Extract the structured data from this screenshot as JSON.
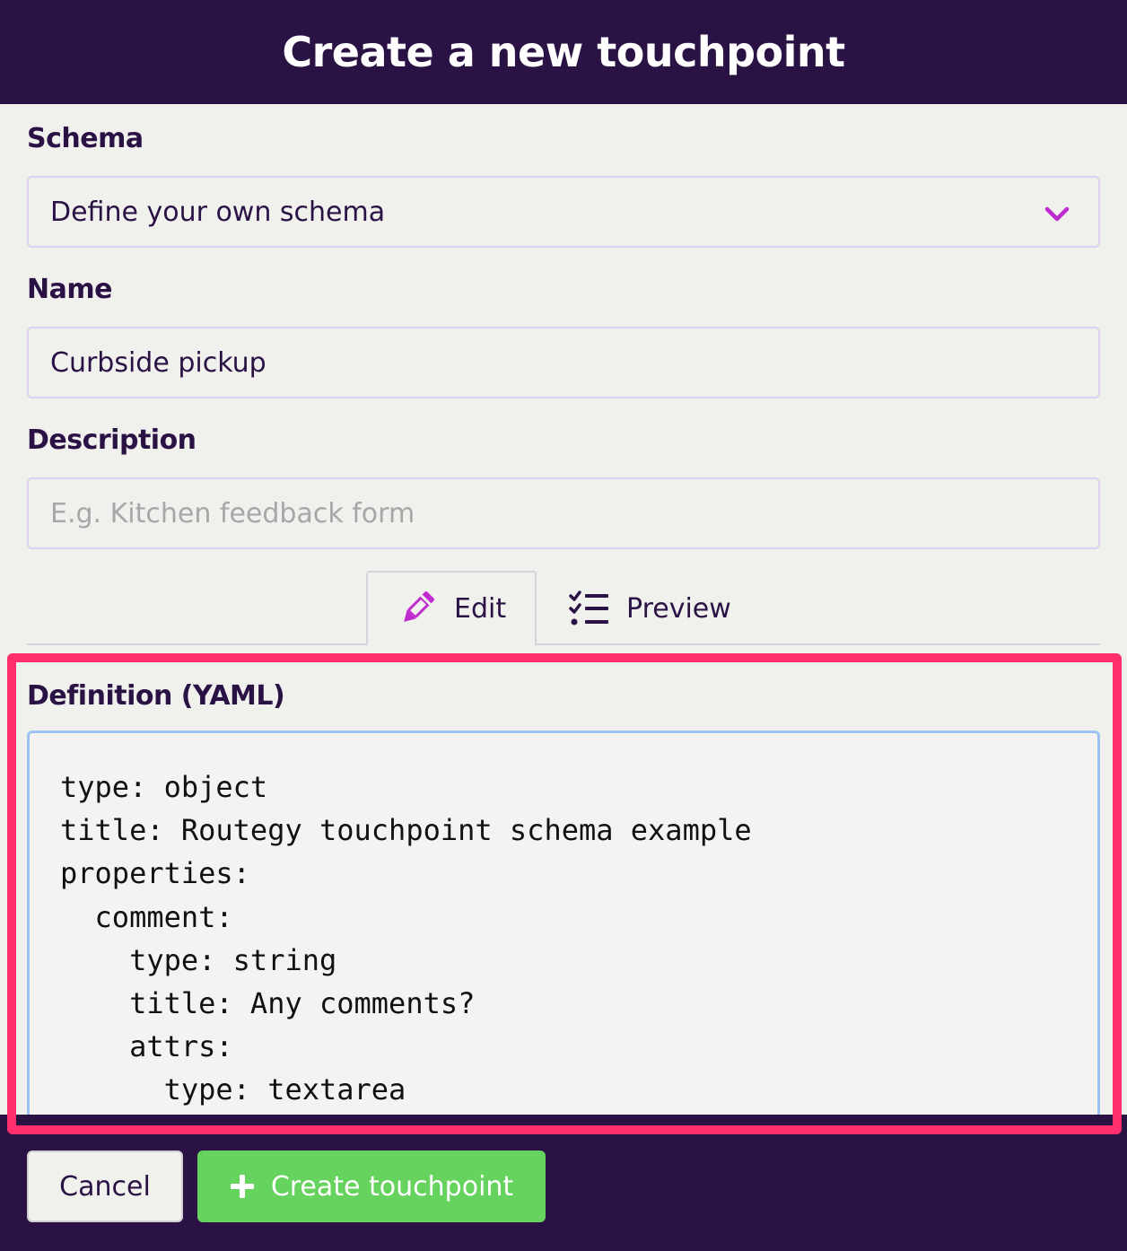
{
  "header": {
    "title": "Create a new touchpoint"
  },
  "form": {
    "schema": {
      "label": "Schema",
      "value": "Define your own schema"
    },
    "name": {
      "label": "Name",
      "value": "Curbside pickup"
    },
    "description": {
      "label": "Description",
      "placeholder": "E.g. Kitchen feedback form"
    }
  },
  "tabs": [
    {
      "label": "Edit",
      "icon": "pencil-icon",
      "active": true
    },
    {
      "label": "Preview",
      "icon": "checklist-icon",
      "active": false
    }
  ],
  "definition": {
    "label": "Definition (YAML)",
    "lines": [
      "type: object",
      "title: Routegy touchpoint schema example",
      "properties:",
      "  comment:",
      "    type: string",
      "    title: Any comments?",
      "    attrs:",
      "      type: textarea"
    ]
  },
  "footer": {
    "cancel_label": "Cancel",
    "create_label": "Create touchpoint"
  },
  "colors": {
    "header_bg": "#2b1245",
    "accent": "#c02bcf",
    "create_button": "#66d35e",
    "highlight": "#ff2e6d",
    "editor_border": "#9cc3f3"
  }
}
